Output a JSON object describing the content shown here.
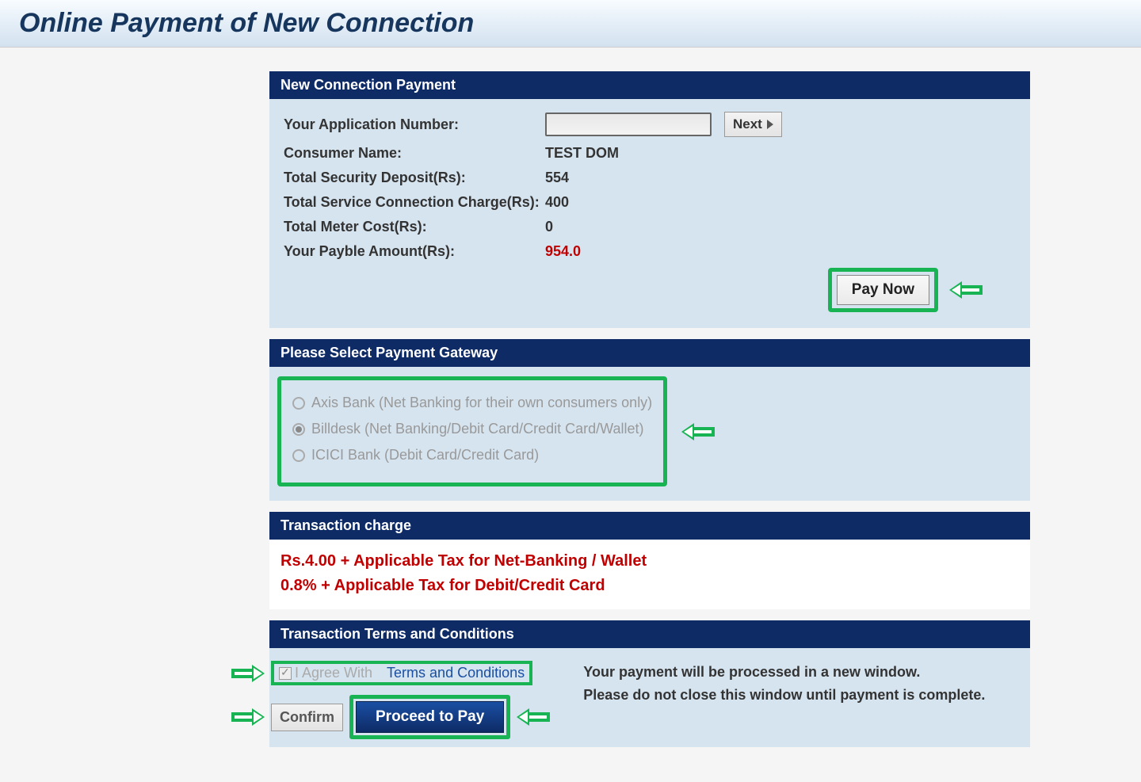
{
  "page": {
    "title": "Online Payment of New Connection"
  },
  "connection": {
    "header": "New Connection Payment",
    "labels": {
      "app_no": "Your Application Number:",
      "consumer": "Consumer Name:",
      "security": "Total Security Deposit(Rs):",
      "service": "Total Service Connection Charge(Rs):",
      "meter": "Total Meter Cost(Rs):",
      "payable": "Your Payble Amount(Rs):"
    },
    "values": {
      "app_no": "",
      "consumer": "TEST DOM",
      "security": "554",
      "service": "400",
      "meter": "0",
      "payable": "954.0"
    },
    "next_label": "Next",
    "paynow_label": "Pay Now"
  },
  "gateway": {
    "header": "Please Select Payment Gateway",
    "options": [
      {
        "label": "Axis Bank (Net Banking for their own consumers only)",
        "selected": false
      },
      {
        "label": "Billdesk (Net Banking/Debit Card/Credit Card/Wallet)",
        "selected": true
      },
      {
        "label": "ICICI Bank (Debit Card/Credit Card)",
        "selected": false
      }
    ]
  },
  "charge": {
    "header": "Transaction charge",
    "line1": "Rs.4.00 + Applicable Tax for Net-Banking / Wallet",
    "line2": "0.8% + Applicable Tax for Debit/Credit Card"
  },
  "terms": {
    "header": "Transaction Terms and Conditions",
    "agree_pre": "I Agree With",
    "agree_link": "Terms and Conditions",
    "info1": "Your payment will be processed in a new window.",
    "info2": "Please do not close this window until payment is complete.",
    "confirm_label": "Confirm",
    "proceed_label": "Proceed to Pay"
  }
}
